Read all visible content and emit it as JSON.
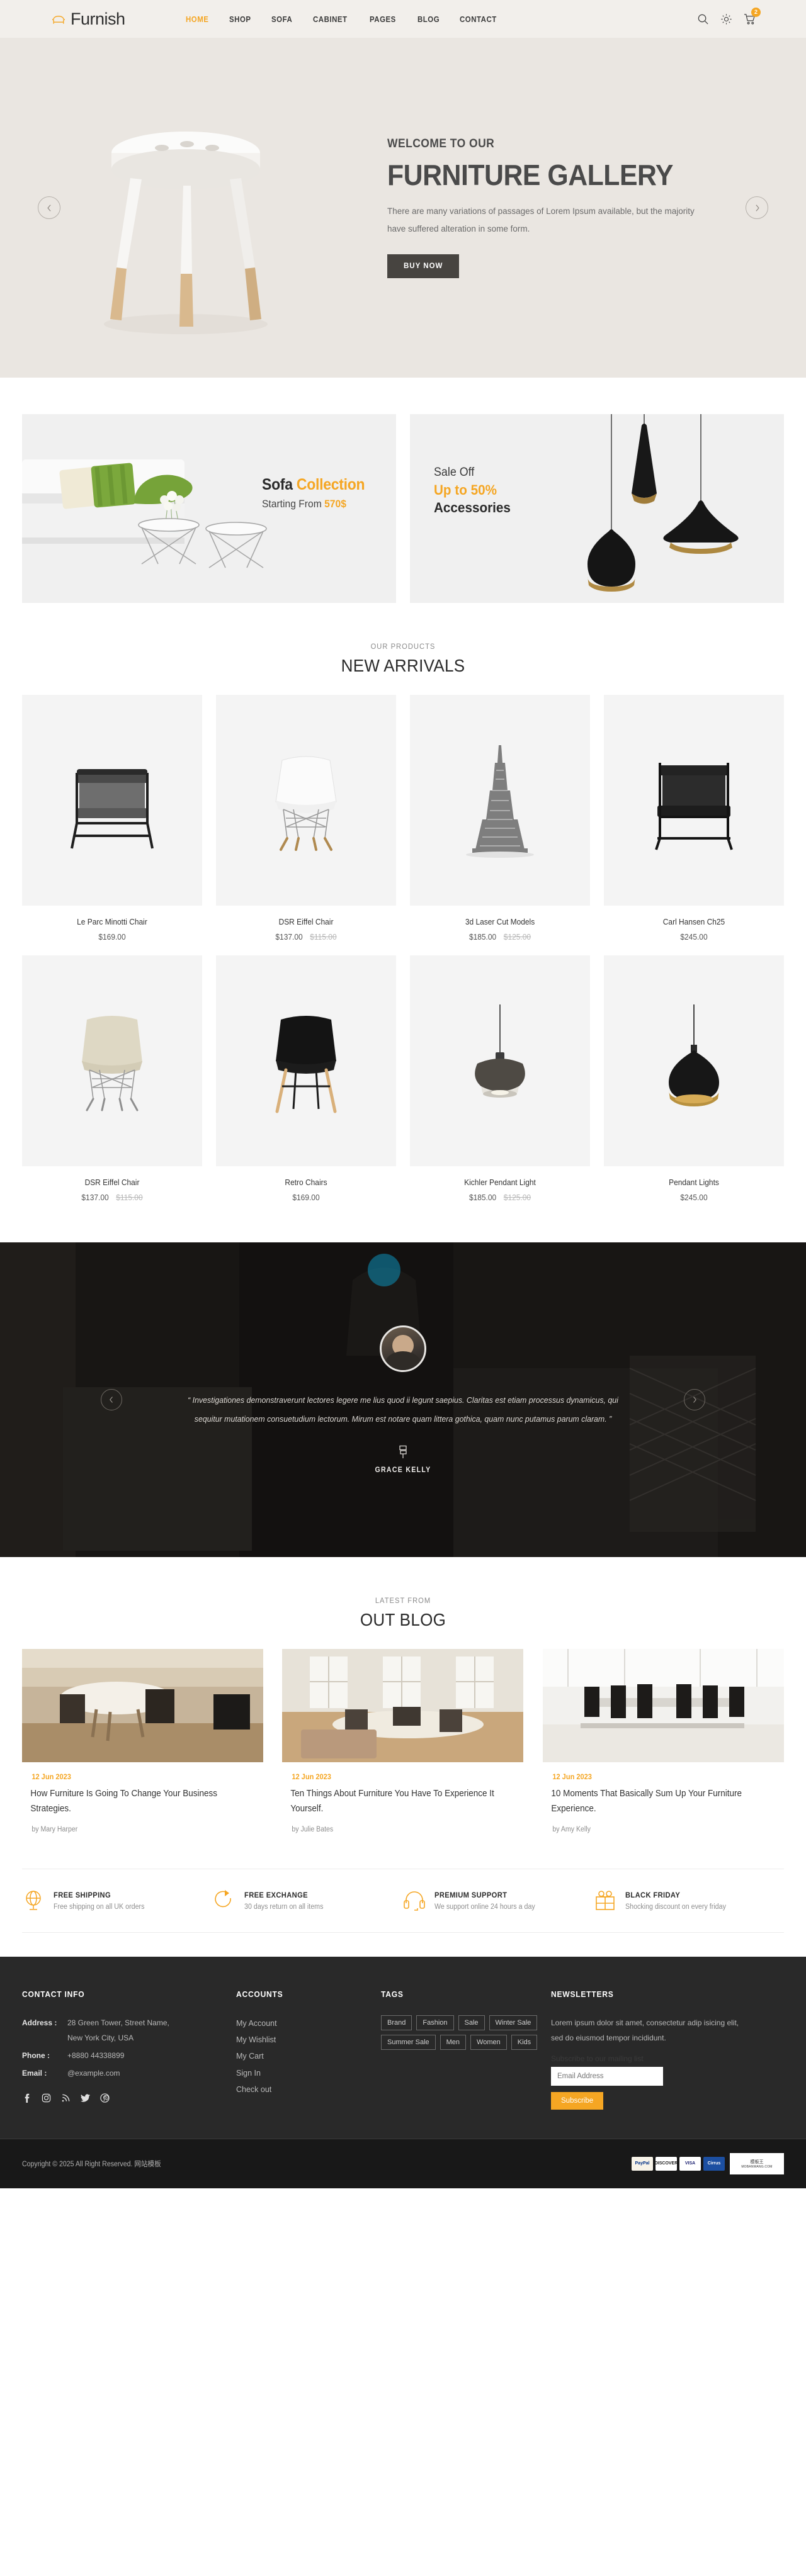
{
  "header": {
    "brand": "Furnish",
    "nav": [
      {
        "label": "HOME",
        "active": true
      },
      {
        "label": "SHOP",
        "active": false
      },
      {
        "label": "SOFA",
        "active": false
      },
      {
        "label": "CABINET",
        "active": false
      },
      {
        "label": "PAGES",
        "active": false
      },
      {
        "label": "BLOG",
        "active": false
      },
      {
        "label": "CONTACT",
        "active": false
      }
    ],
    "cart_count": "2"
  },
  "hero": {
    "kicker": "WELCOME TO OUR",
    "title": "FURNITURE GALLERY",
    "desc": "There are many variations of passages of Lorem Ipsum available, but the majority have suffered alteration in some form.",
    "cta": "BUY NOW"
  },
  "promos": {
    "left": {
      "title_black": "Sofa",
      "title_accent": "Collection",
      "sub_prefix": "Starting From",
      "sub_accent": "570$"
    },
    "right": {
      "line1": "Sale Off",
      "line2": "Up to 50%",
      "line3": "Accessories"
    }
  },
  "products_section": {
    "kicker": "OUR PRODUCTS",
    "title": "NEW ARRIVALS",
    "items": [
      {
        "name": "Le Parc Minotti Chair",
        "price": "$169.00",
        "old_price": ""
      },
      {
        "name": "DSR Eiffel Chair",
        "price": "$137.00",
        "old_price": "$115.00"
      },
      {
        "name": "3d Laser Cut Models",
        "price": "$185.00",
        "old_price": "$125.00"
      },
      {
        "name": "Carl Hansen Ch25",
        "price": "$245.00",
        "old_price": ""
      },
      {
        "name": "DSR Eiffel Chair",
        "price": "$137.00",
        "old_price": "$115.00"
      },
      {
        "name": "Retro Chairs",
        "price": "$169.00",
        "old_price": ""
      },
      {
        "name": "Kichler Pendant Light",
        "price": "$185.00",
        "old_price": "$125.00"
      },
      {
        "name": "Pendant Lights",
        "price": "$245.00",
        "old_price": ""
      }
    ]
  },
  "testimonial": {
    "quote": "“ Investigationes demonstraverunt lectores legere me lius quod ii legunt saepius. Claritas est etiam processus dynamicus, qui sequitur mutationem consuetudium lectorum. Mirum est notare quam littera gothica, quam nunc putamus parum claram. ”",
    "name": "GRACE KELLY"
  },
  "blog_section": {
    "kicker": "LATEST FROM",
    "title": "OUT BLOG",
    "posts": [
      {
        "date": "12 Jun 2023",
        "title": "How Furniture Is Going To Change Your Business Strategies.",
        "author": "by Mary Harper"
      },
      {
        "date": "12 Jun 2023",
        "title": "Ten Things About Furniture You Have To Experience It Yourself.",
        "author": "by Julie Bates"
      },
      {
        "date": "12 Jun 2023",
        "title": "10 Moments That Basically Sum Up Your Furniture Experience.",
        "author": "by Amy Kelly"
      }
    ]
  },
  "features": [
    {
      "icon": "globe-icon",
      "title": "FREE SHIPPING",
      "sub": "Free shipping on all UK orders"
    },
    {
      "icon": "refresh-icon",
      "title": "FREE EXCHANGE",
      "sub": "30 days return on all items"
    },
    {
      "icon": "headset-icon",
      "title": "PREMIUM SUPPORT",
      "sub": "We support online 24 hours a day"
    },
    {
      "icon": "gift-icon",
      "title": "BLACK FRIDAY",
      "sub": "Shocking discount on every friday"
    }
  ],
  "footer": {
    "contact": {
      "title": "CONTACT INFO",
      "address_label": "Address :",
      "address_line1": "28 Green Tower, Street Name,",
      "address_line2": "New York City, USA",
      "phone_label": "Phone :",
      "phone_value": "+8880 44338899",
      "email_label": "Email :",
      "email_value": "@example.com",
      "socials": [
        "facebook-icon",
        "instagram-icon",
        "rss-icon",
        "twitter-icon",
        "pinterest-icon"
      ]
    },
    "accounts": {
      "title": "ACCOUNTS",
      "links": [
        "My Account",
        "My Wishlist",
        "My Cart",
        "Sign In",
        "Check out"
      ]
    },
    "tags": {
      "title": "TAGS",
      "items": [
        "Brand",
        "Fashion",
        "Sale",
        "Winter Sale",
        "Summer Sale",
        "Men",
        "Women",
        "Kids"
      ]
    },
    "newsletters": {
      "title": "NEWSLETTERS",
      "desc": "Lorem ipsum dolor sit amet, consectetur adip isicing elit, sed do eiusmod tempor incididunt.",
      "sub_note": "Subscribe to our mailing list",
      "placeholder": "Email Address",
      "button": "Subscribe"
    },
    "copyright": "Copyright © 2025 All Right Reserved. 网站模板",
    "payments": [
      "PayPal",
      "DISCOVER",
      "VISA",
      "Cirrus"
    ],
    "watermark_top": "模板王",
    "watermark_bottom": "MOBANWANG.COM"
  },
  "colors": {
    "accent": "#f5a623",
    "header_bg": "#f2efeb",
    "hero_bg": "#eae6e1",
    "footer_bg": "#292929",
    "dark": "#474440"
  }
}
